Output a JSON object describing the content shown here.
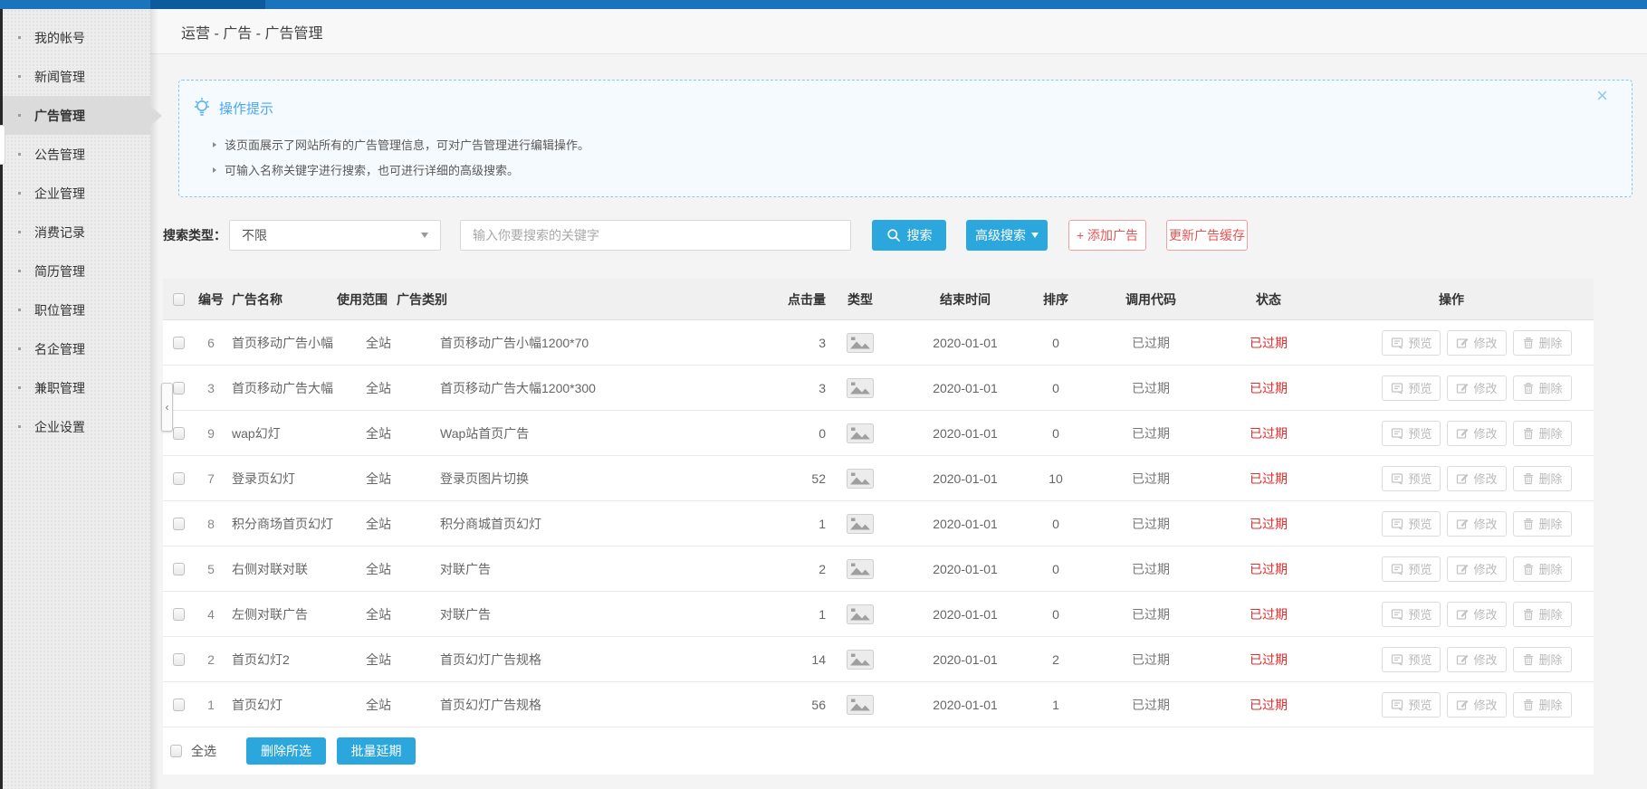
{
  "breadcrumb": "运营 - 广告 - 广告管理",
  "sidebar": {
    "items": [
      {
        "label": "我的帐号",
        "active": false
      },
      {
        "label": "新闻管理",
        "active": false
      },
      {
        "label": "广告管理",
        "active": true
      },
      {
        "label": "公告管理",
        "active": false
      },
      {
        "label": "企业管理",
        "active": false
      },
      {
        "label": "消费记录",
        "active": false
      },
      {
        "label": "简历管理",
        "active": false
      },
      {
        "label": "职位管理",
        "active": false
      },
      {
        "label": "名企管理",
        "active": false
      },
      {
        "label": "兼职管理",
        "active": false
      },
      {
        "label": "企业设置",
        "active": false
      }
    ],
    "collapse_glyph": "‹"
  },
  "tip": {
    "title": "操作提示",
    "lines": [
      "该页面展示了网站所有的广告管理信息，可对广告管理进行编辑操作。",
      "可输入名称关键字进行搜索，也可进行详细的高级搜索。"
    ],
    "close_glyph": "×"
  },
  "search": {
    "type_label": "搜索类型：",
    "type_value": "不限",
    "keyword_placeholder": "输入你要搜索的关键字",
    "search_label": "搜索",
    "advanced_label": "高级搜索",
    "add_label": "+ 添加广告",
    "refresh_label": "更新广告缓存"
  },
  "table": {
    "headers": {
      "id": "编号",
      "name": "广告名称",
      "scope": "使用范围",
      "category": "广告类别",
      "clicks": "点击量",
      "type": "类型",
      "end_date": "结束时间",
      "sort": "排序",
      "code": "调用代码",
      "status": "状态",
      "ops": "操作"
    },
    "action_labels": {
      "preview": "预览",
      "edit": "修改",
      "delete": "删除"
    },
    "rows": [
      {
        "id": "6",
        "name": "首页移动广告小幅",
        "scope": "全站",
        "category": "首页移动广告小幅1200*70",
        "clicks": "3",
        "end_date": "2020-01-01",
        "sort": "0",
        "code_status": "已过期",
        "status": "已过期"
      },
      {
        "id": "3",
        "name": "首页移动广告大幅",
        "scope": "全站",
        "category": "首页移动广告大幅1200*300",
        "clicks": "3",
        "end_date": "2020-01-01",
        "sort": "0",
        "code_status": "已过期",
        "status": "已过期"
      },
      {
        "id": "9",
        "name": "wap幻灯",
        "scope": "全站",
        "category": "Wap站首页广告",
        "clicks": "0",
        "end_date": "2020-01-01",
        "sort": "0",
        "code_status": "已过期",
        "status": "已过期"
      },
      {
        "id": "7",
        "name": "登录页幻灯",
        "scope": "全站",
        "category": "登录页图片切换",
        "clicks": "52",
        "end_date": "2020-01-01",
        "sort": "10",
        "code_status": "已过期",
        "status": "已过期"
      },
      {
        "id": "8",
        "name": "积分商场首页幻灯",
        "scope": "全站",
        "category": "积分商城首页幻灯",
        "clicks": "1",
        "end_date": "2020-01-01",
        "sort": "0",
        "code_status": "已过期",
        "status": "已过期"
      },
      {
        "id": "5",
        "name": "右侧对联对联",
        "scope": "全站",
        "category": "对联广告",
        "clicks": "2",
        "end_date": "2020-01-01",
        "sort": "0",
        "code_status": "已过期",
        "status": "已过期"
      },
      {
        "id": "4",
        "name": "左侧对联广告",
        "scope": "全站",
        "category": "对联广告",
        "clicks": "1",
        "end_date": "2020-01-01",
        "sort": "0",
        "code_status": "已过期",
        "status": "已过期"
      },
      {
        "id": "2",
        "name": "首页幻灯2",
        "scope": "全站",
        "category": "首页幻灯广告规格",
        "clicks": "14",
        "end_date": "2020-01-01",
        "sort": "2",
        "code_status": "已过期",
        "status": "已过期"
      },
      {
        "id": "1",
        "name": "首页幻灯",
        "scope": "全站",
        "category": "首页幻灯广告规格",
        "clicks": "56",
        "end_date": "2020-01-01",
        "sort": "1",
        "code_status": "已过期",
        "status": "已过期"
      }
    ]
  },
  "footer": {
    "select_all_label": "全选",
    "delete_selected_label": "删除所选",
    "batch_extend_label": "批量延期"
  },
  "colors": {
    "topbar_blue": "#1b74bb",
    "topbar_dark_blue": "#0d5b9f",
    "accent_blue": "#2ba7dd",
    "tip_blue": "#47a7f6",
    "status_red": "#e62b2b",
    "red_button_border": "#f0a0a0"
  }
}
